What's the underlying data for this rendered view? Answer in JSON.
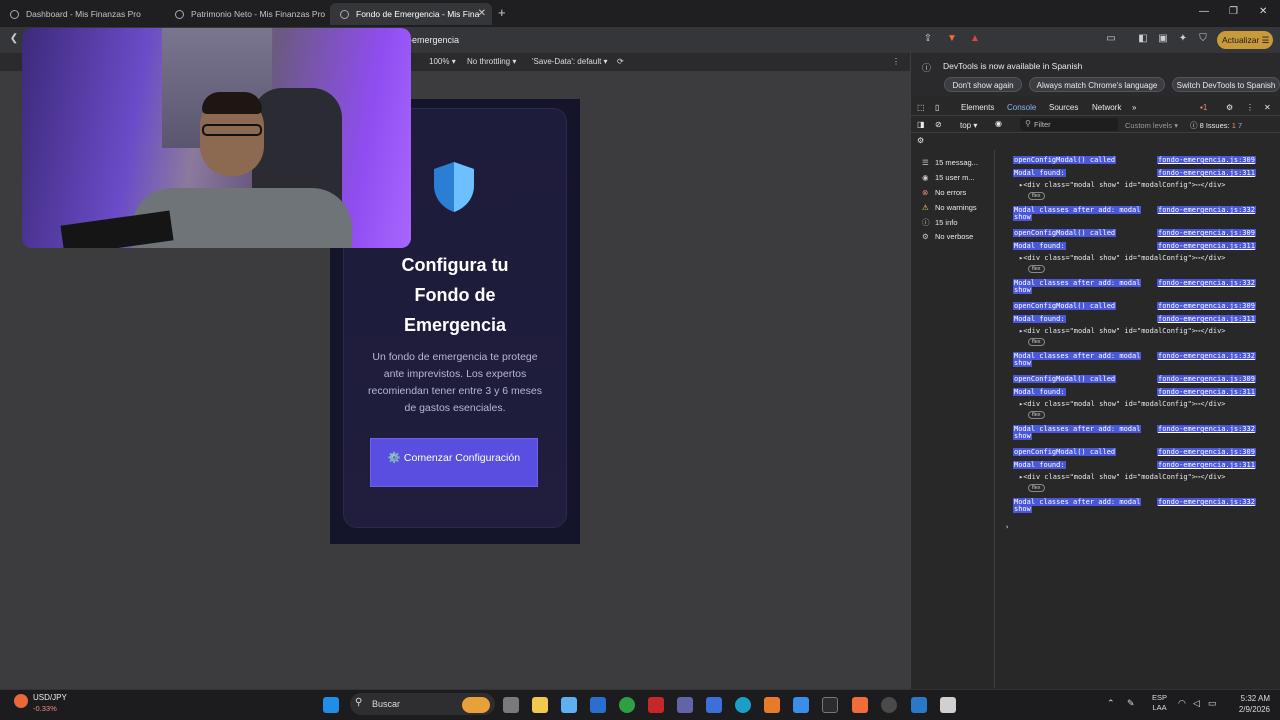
{
  "browser": {
    "tabs": [
      {
        "title": "Dashboard - Mis Finanzas Pro"
      },
      {
        "title": "Patrimonio Neto - Mis Finanzas Pro"
      },
      {
        "title": "Fondo de Emergencia - Mis Fina"
      }
    ],
    "new_tab_icon": "plus-icon",
    "url_text": "o-emergencia",
    "update_label": "Actualizar"
  },
  "device_toolbar": {
    "zoom": "100%",
    "throttle": "No throttling",
    "save_data": "'Save-Data': default"
  },
  "app": {
    "title": "Configura tu Fondo de Emergencia",
    "description": "Un fondo de emergencia te protege ante imprevistos. Los expertos recomiendan tener entre 3 y 6 meses de gastos esenciales.",
    "start_button": "⚙️ Comenzar Configuración",
    "shield_color": "#3aa0f0"
  },
  "devtools": {
    "notice": "DevTools is now available in Spanish",
    "notice_buttons": [
      "Don't show again",
      "Always match Chrome's language",
      "Switch DevTools to Spanish"
    ],
    "tabs": [
      "Elements",
      "Console",
      "Sources",
      "Network"
    ],
    "context": "top",
    "filter_placeholder": "Filter",
    "levels": "Custom levels",
    "issues": "8 Issues:",
    "issues_err": "1",
    "issues_info": "7",
    "tab_error_count": "1",
    "sidebar": [
      {
        "icon": "list-icon",
        "label": "15 messag..."
      },
      {
        "icon": "user-icon",
        "label": "15 user m..."
      },
      {
        "icon": "error-icon",
        "label": "No errors"
      },
      {
        "icon": "warning-icon",
        "label": "No warnings"
      },
      {
        "icon": "info-icon",
        "label": "15 info"
      },
      {
        "icon": "verbose-icon",
        "label": "No verbose"
      }
    ],
    "log_entries": [
      {
        "text": "openConfigModal() called",
        "src": "fondo-emergencia.js:309"
      },
      {
        "text": "Modal found:",
        "src": "fondo-emergencia.js:311"
      },
      {
        "text": "▸<div class=\"modal show\" id=\"modalConfig\">⋯</div>",
        "src": ""
      },
      {
        "text": "Modal classes after add: modal",
        "src": "fondo-emergencia.js:332"
      },
      {
        "text": "show",
        "src": ""
      }
    ],
    "chip_label": "flex"
  },
  "taskbar": {
    "ticker": "USD/JPY",
    "ticker_change": "-0.33%",
    "search": "Buscar",
    "lang": "ESP",
    "lang2": "LAA",
    "time": "5:32 AM",
    "date": "2/9/2026"
  }
}
